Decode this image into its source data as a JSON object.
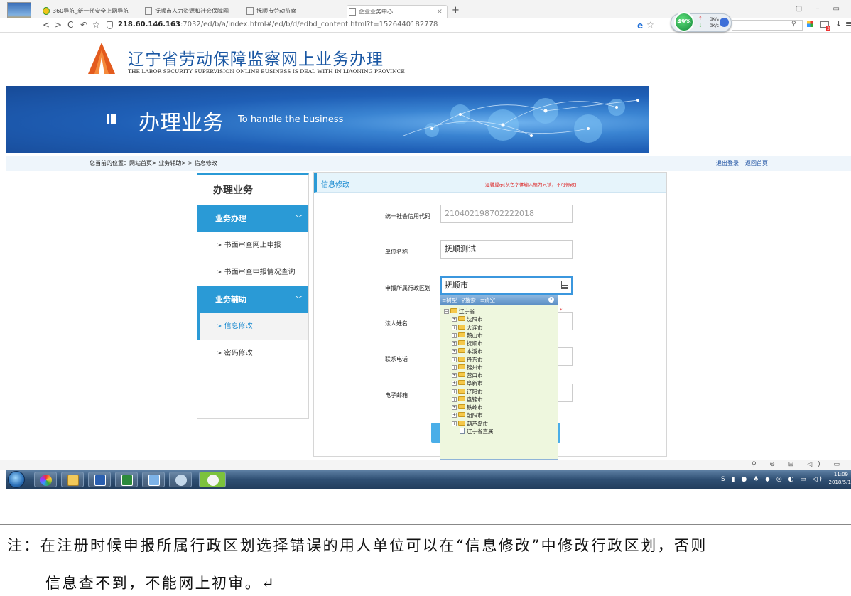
{
  "browser": {
    "tabs": [
      {
        "label": "360导航_新一代安全上网导航",
        "active": false
      },
      {
        "label": "抚顺市人力资源和社会保障网",
        "active": false
      },
      {
        "label": "抚顺市劳动监察",
        "active": false
      },
      {
        "label": "企业业务中心",
        "active": true
      }
    ],
    "close_glyph": "×",
    "plus_glyph": "+",
    "window_controls": "▢ – ▭",
    "url_host": "218.60.146.163",
    "url_path": ":7032/ed/b/a/index.html#/ed/b/d/edbd_content.html?t=1526440182778",
    "netmon_percent": "49%",
    "netmon_up": "0K/s",
    "netmon_down": "0K/s",
    "mail_badge": "3",
    "icons": [
      "back-icon",
      "forward-icon",
      "reload-icon",
      "undo-icon",
      "bookmark-star-icon",
      "shield-icon",
      "ie-icon",
      "search-icon",
      "apps-icon",
      "mail-icon",
      "download-icon",
      "menu-icon"
    ]
  },
  "site": {
    "title": "辽宁省劳动保障监察网上业务办理",
    "subtitle": "THE LABOR SECURITY SUPERVISION ONLINE BUSINESS IS DEAL WITH IN LIAONING PROVINCE",
    "banner_title": "办理业务",
    "banner_subtitle": "To handle the business",
    "breadcrumb": "您当前的位置：网站首页> 业务辅助> > 信息修改",
    "logout": "退出登录",
    "home": "返回首页"
  },
  "menu": {
    "heading": "办理业务",
    "sections": [
      {
        "label": "业务办理",
        "items": [
          "书面审查网上申报",
          "书面审查申报情况查询"
        ]
      },
      {
        "label": "业务辅助",
        "items": [
          "信息修改",
          "密码修改"
        ]
      }
    ],
    "active_item": "信息修改",
    "chevron": "﹀",
    "bullet": ">"
  },
  "form": {
    "title": "信息修改",
    "hint": "温馨提示[灰色字体输入框为只读，不可修改]",
    "fields": {
      "credit_code": {
        "label": "统一社会信用代码",
        "value": "210402198702222018"
      },
      "unit_name": {
        "label": "单位名称",
        "value": "抚顺测试"
      },
      "region": {
        "label": "申报所属行政区划",
        "value": "抚顺市"
      },
      "legal_person": {
        "label": "法人姓名",
        "value": ""
      },
      "phone": {
        "label": "联系电话",
        "value": ""
      },
      "email": {
        "label": "电子邮箱",
        "value": ""
      }
    },
    "error_mark": "*"
  },
  "tree": {
    "toolbar": [
      "树型",
      "搜索",
      "清空"
    ],
    "root": "辽宁省",
    "cities": [
      "沈阳市",
      "大连市",
      "鞍山市",
      "抚顺市",
      "本溪市",
      "丹东市",
      "锦州市",
      "营口市",
      "阜新市",
      "辽阳市",
      "盘锦市",
      "铁岭市",
      "朝阳市",
      "葫芦岛市"
    ],
    "direct": "辽宁省直属",
    "toggle_plus": "+",
    "toggle_minus": "−",
    "close_glyph": "×"
  },
  "taskbar": {
    "apps": [
      "start-orb",
      "browser-360",
      "file-explorer",
      "word",
      "excel",
      "remote-desktop",
      "media-player",
      "wechat"
    ],
    "time": "11:09",
    "date": "2018/5/1",
    "strip_icons": "⚲ ⊚ ⊞ ◁) ▭",
    "tray_icons": "S ▮ ● ♣ ◆ ◎ ◐ ▭ ◁)"
  },
  "note": {
    "line1": "注：在注册时候申报所属行政区划选择错误的用人单位可以在“信息修改”中修改行政区划，否则",
    "line2": "信息查不到，不能网上初审。↵"
  }
}
